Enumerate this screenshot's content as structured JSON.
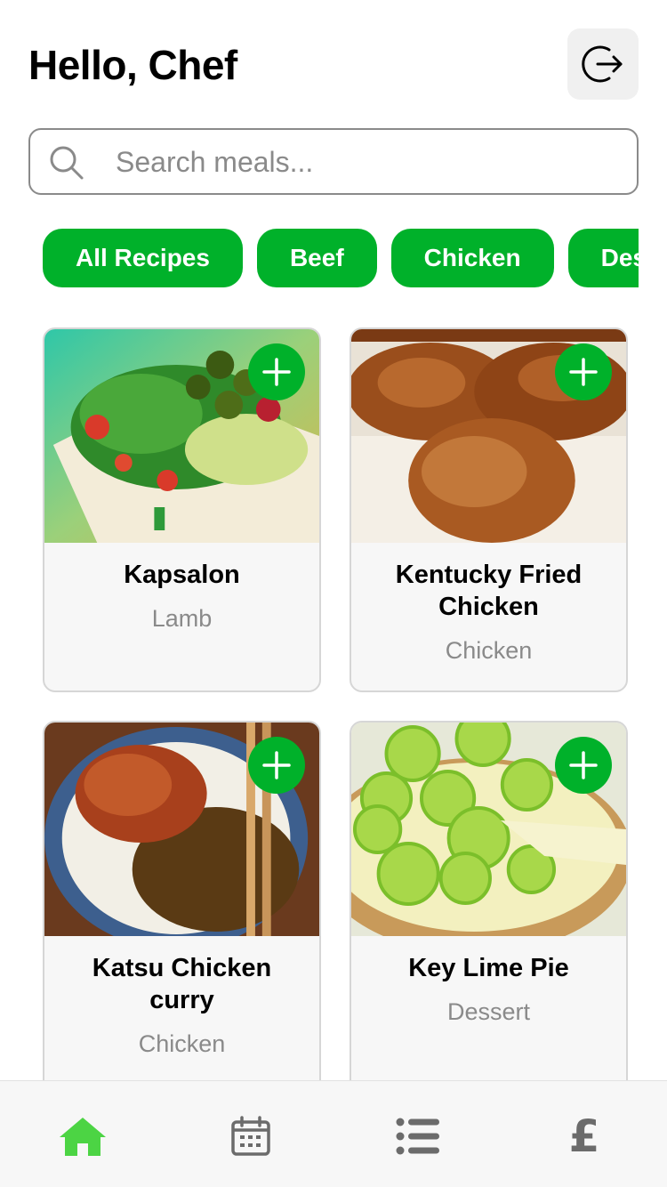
{
  "header": {
    "greeting": "Hello, Chef",
    "logout_icon": "logout-icon"
  },
  "search": {
    "placeholder": "Search meals...",
    "value": "",
    "icon": "search-icon"
  },
  "filters": [
    {
      "label": "All Recipes"
    },
    {
      "label": "Beef"
    },
    {
      "label": "Chicken"
    },
    {
      "label": "Dessert"
    }
  ],
  "meals": [
    {
      "title": "Kapsalon",
      "category": "Lamb"
    },
    {
      "title": "Kentucky Fried Chicken",
      "category": "Chicken"
    },
    {
      "title": "Katsu Chicken curry",
      "category": "Chicken"
    },
    {
      "title": "Key Lime Pie",
      "category": "Dessert"
    }
  ],
  "tabbar": {
    "tabs": [
      {
        "icon": "home-icon",
        "active": true
      },
      {
        "icon": "calendar-icon",
        "active": false
      },
      {
        "icon": "list-icon",
        "active": false
      },
      {
        "icon": "pound-icon",
        "active": false
      }
    ],
    "pound_symbol": "£"
  },
  "colors": {
    "accent": "#00b12a",
    "active_tab": "#4cd444",
    "inactive_tab": "#6b6b6b",
    "muted_text": "#8a8a8a"
  }
}
